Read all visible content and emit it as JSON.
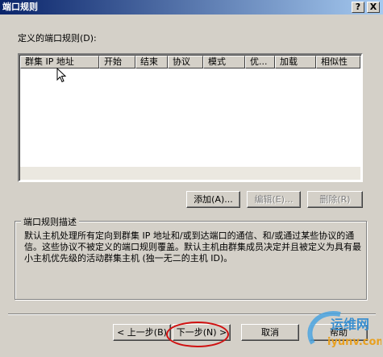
{
  "window": {
    "title": "端口规则",
    "help_button": "?",
    "close_button": "X"
  },
  "rules_label": "定义的端口规则(D):",
  "columns": [
    "群集 IP 地址",
    "开始",
    "结束",
    "协议",
    "模式",
    "优...",
    "加载",
    "相似性"
  ],
  "buttons": {
    "add": "添加(A)...",
    "edit": "编辑(E)...",
    "delete": "删除(R)",
    "back": "< 上一步(B)",
    "next": "下一步(N) >",
    "cancel": "取消",
    "help": "帮助"
  },
  "description": {
    "title": "端口规则描述",
    "text": "默认主机处理所有定向到群集 IP 地址和/或到达端口的通信、和/或通过某些协议的通信。这些协议不被定义的端口规则覆盖。默认主机由群集成员决定并且被定义为具有最小主机优先级的活动群集主机 (独一无二的主机 ID)。"
  },
  "watermark": {
    "line1": "运维网",
    "line2": "iyunv.com"
  },
  "colors": {
    "titlebar_start": "#0a246a",
    "titlebar_end": "#a6caf0",
    "highlight_oval": "#d01010"
  }
}
